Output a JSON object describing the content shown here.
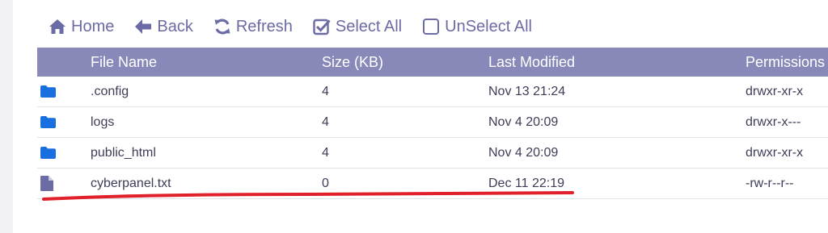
{
  "toolbar": {
    "home_label": "Home",
    "back_label": "Back",
    "refresh_label": "Refresh",
    "select_all_label": "Select All",
    "unselect_all_label": "UnSelect All"
  },
  "table": {
    "columns": [
      "File Name",
      "Size (KB)",
      "Last Modified",
      "Permissions"
    ],
    "rows": [
      {
        "type": "folder-icon",
        "name": ".config",
        "size": "4",
        "modified": "Nov 13 21:24",
        "permissions": "drwxr-xr-x"
      },
      {
        "type": "folder-icon",
        "name": "logs",
        "size": "4",
        "modified": "Nov 4 20:09",
        "permissions": "drwxr-x---"
      },
      {
        "type": "folder-icon",
        "name": "public_html",
        "size": "4",
        "modified": "Nov 4 20:09",
        "permissions": "drwxr-xr-x"
      },
      {
        "type": "file-icon",
        "name": "cyberpanel.txt",
        "size": "0",
        "modified": "Dec 11 22:19",
        "permissions": "-rw-r--r--"
      }
    ]
  },
  "colors": {
    "accent": "#6b6ba6",
    "header_bg": "#8989b9",
    "folder": "#1a6fe0",
    "file": "#6b6ba6",
    "annotation_underline": "#e0202a"
  }
}
